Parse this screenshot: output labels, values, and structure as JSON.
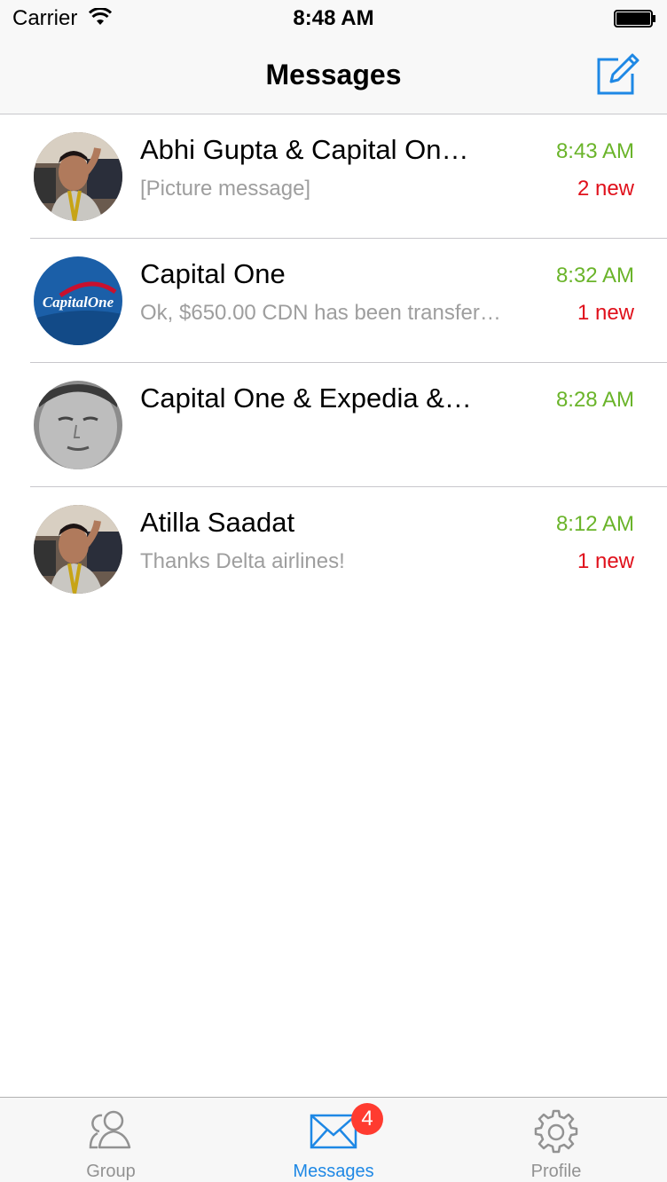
{
  "status_bar": {
    "carrier": "Carrier",
    "time": "8:48 AM"
  },
  "nav": {
    "title": "Messages",
    "compose_icon": "compose-icon"
  },
  "conversations": [
    {
      "name": "Abhi Gupta & Capital On…",
      "preview": "[Picture message]",
      "time": "8:43 AM",
      "new": "2 new",
      "avatar": "person-selfie"
    },
    {
      "name": "Capital One",
      "preview": "Ok, $650.00 CDN has been transfer…",
      "time": "8:32 AM",
      "new": "1 new",
      "avatar": "capital-one-logo",
      "logo_text": "CapitalOne"
    },
    {
      "name": "Capital One  & Expedia &…",
      "preview": "",
      "time": "8:28 AM",
      "new": "",
      "avatar": "person-face-gray"
    },
    {
      "name": "Atilla Saadat",
      "preview": "Thanks Delta airlines!",
      "time": "8:12 AM",
      "new": "1 new",
      "avatar": "person-selfie"
    }
  ],
  "tabs": [
    {
      "label": "Group",
      "icon": "group-icon",
      "active": false
    },
    {
      "label": "Messages",
      "icon": "envelope-icon",
      "active": true,
      "badge": "4"
    },
    {
      "label": "Profile",
      "icon": "gear-icon",
      "active": false
    }
  ],
  "colors": {
    "time": "#6ab42a",
    "new": "#e0101b",
    "accent": "#1e88e5",
    "badge": "#ff3b30",
    "preview": "#9e9e9e"
  }
}
